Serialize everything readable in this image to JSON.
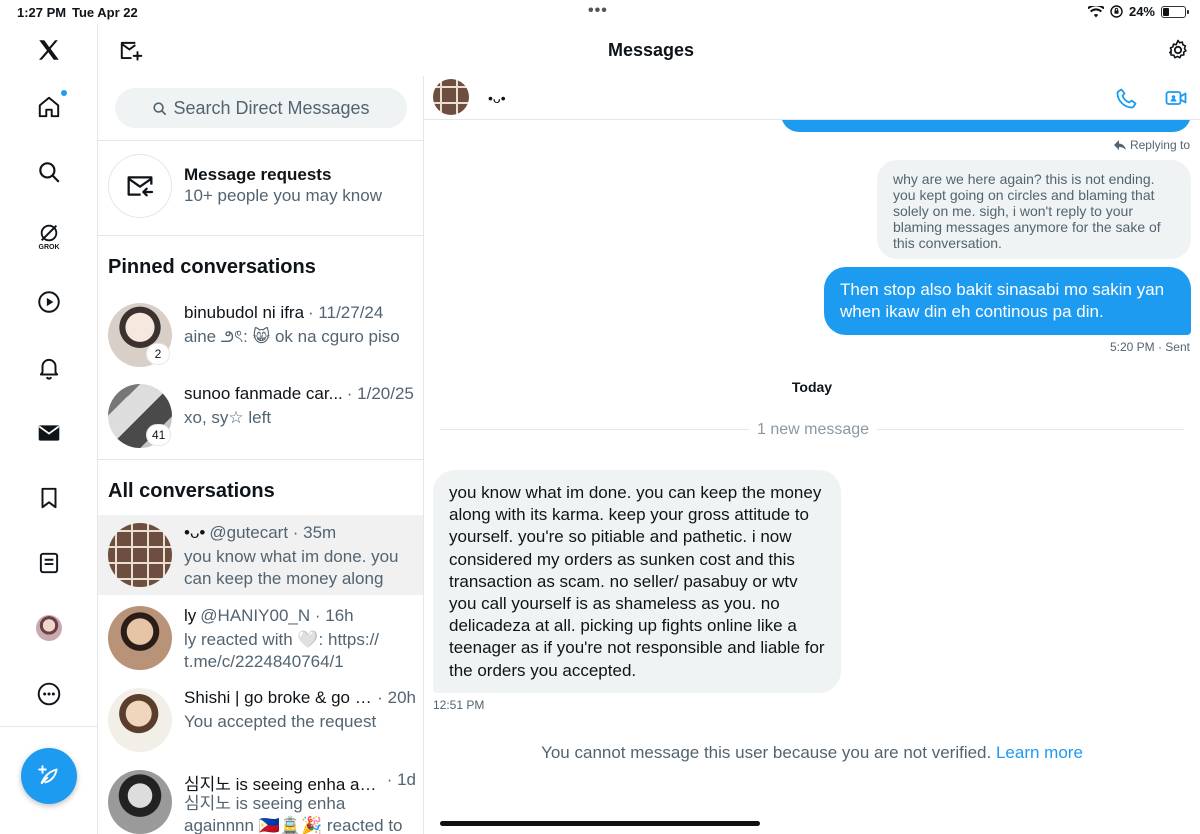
{
  "status_bar": {
    "time": "1:27 PM",
    "date": "Tue Apr 22",
    "battery": "24%",
    "battery_level": 0.24
  },
  "header": {
    "title": "Messages"
  },
  "nav": {
    "items": [
      "x-logo-icon",
      "home-icon",
      "search-icon",
      "grok-icon",
      "video-icon",
      "bell-icon",
      "mail-icon",
      "bookmark-icon",
      "list-icon",
      "profile-avatar",
      "more-icon"
    ],
    "grok_label": "GROK"
  },
  "search": {
    "placeholder": "Search Direct Messages"
  },
  "requests": {
    "title": "Message requests",
    "subtitle": "10+ people you may know"
  },
  "pinned": {
    "heading": "Pinned conversations",
    "items": [
      {
        "name": "binubudol ni ifra",
        "meta": "· 11/27/24",
        "preview": "aine ౨ৎ: 😸 ok na cguro piso",
        "badge": "2"
      },
      {
        "name": "sunoo fanmade car...",
        "meta": "· 1/20/25",
        "preview": "xo, sy☆ left",
        "badge": "41"
      }
    ]
  },
  "all": {
    "heading": "All conversations",
    "items": [
      {
        "name": "•ᴗ•",
        "meta": "@gutecart · 35m",
        "preview": "you know what im done. you can keep the money along with"
      },
      {
        "name": "ly",
        "meta": "@HANIY00_N · 16h",
        "preview": "ly reacted with 🤍: https:// t.me/c/2224840764/1"
      },
      {
        "name": "Shishi | go broke & go h...",
        "meta": "· 20h",
        "preview": "You accepted the request"
      },
      {
        "name": "심지노 is seeing enha agai...",
        "meta": "· 1d",
        "preview": "심지노 is seeing enha againnnn 🇵🇭🚊🎉 reacted to a photo"
      }
    ]
  },
  "chat": {
    "contact_name": "•ᴗ•",
    "replying_label": "Replying to",
    "quoted_text": "why are we here again? this is not ending. you kept going on circles and blaming that solely on me. sigh, i won't reply to your blaming messages anymore for the sake of this conversation.",
    "sent_text": "Then stop also bakit sinasabi mo sakin yan when ikaw din eh continous pa din.",
    "sent_meta": "5:20 PM · Sent",
    "day_label": "Today",
    "new_label": "1 new message",
    "received_text": "you know what im done. you can keep the money along with its karma. keep your gross attitude to yourself. you're so pitiable and pathetic. i now considered my orders as sunken cost and this transaction as scam. no seller/ pasabuy or wtv you call yourself is as shameless as you. no delicadeza at all. picking up fights online like a teenager as if you're not responsible and liable for the orders you accepted.",
    "received_time": "12:51 PM",
    "notice": "You cannot message this user because you are not verified.",
    "learn_more": "Learn more"
  },
  "colors": {
    "accent": "#1d9bf0",
    "bubble_gray": "#eff3f4",
    "muted": "#536471"
  }
}
